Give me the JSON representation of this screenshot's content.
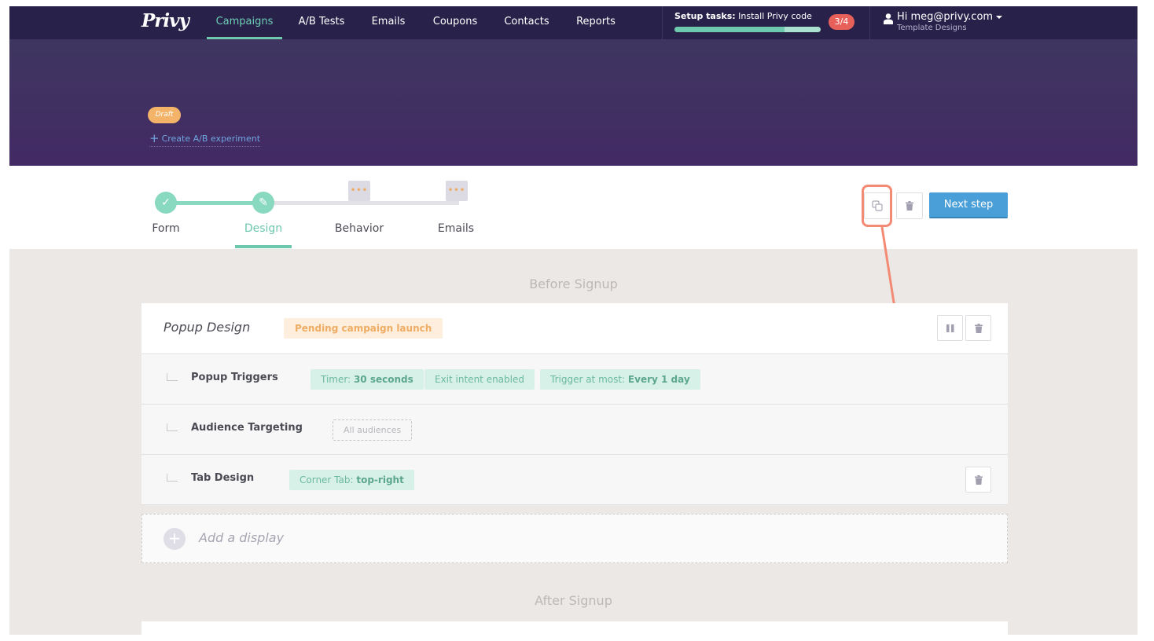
{
  "nav": {
    "logo": "Privy",
    "items": [
      {
        "label": "Campaigns",
        "active": true
      },
      {
        "label": "A/B Tests",
        "active": false
      },
      {
        "label": "Emails",
        "active": false
      },
      {
        "label": "Coupons",
        "active": false
      },
      {
        "label": "Contacts",
        "active": false
      },
      {
        "label": "Reports",
        "active": false
      }
    ],
    "setup": {
      "prefix": "Setup tasks:",
      "task": "Install Privy code",
      "count": "3/4",
      "progress_fraction": 0.75
    },
    "user": {
      "greeting": "Hi meg@privy.com",
      "org": "Template Designs"
    }
  },
  "banner": {
    "status_badge": "Draft",
    "ab_link_icon": "+",
    "ab_link": "Create A/B experiment"
  },
  "steps": {
    "items": [
      {
        "label": "Form",
        "state": "done",
        "icon": "check-icon",
        "glyph": "✓"
      },
      {
        "label": "Design",
        "state": "current",
        "icon": "brush-icon",
        "glyph": "✎"
      },
      {
        "label": "Behavior",
        "state": "pending",
        "icon": "ellipsis-icon",
        "glyph": "•••"
      },
      {
        "label": "Emails",
        "state": "pending",
        "icon": "ellipsis-icon",
        "glyph": "•••"
      }
    ],
    "actions": {
      "duplicate_icon": "duplicate-icon",
      "delete_icon": "trash-icon",
      "next_label": "Next step"
    }
  },
  "colors": {
    "nav_bg": "#28214a",
    "accent_green": "#6ec8ae",
    "primary_blue": "#4a9fd8",
    "badge_red": "#e8605a",
    "draft_orange": "#f3b46a",
    "annotation": "#f38a74"
  },
  "before_signup": {
    "title": "Before Signup",
    "popup": {
      "title": "Popup Design",
      "status": "Pending campaign launch"
    },
    "rows": [
      {
        "label": "Popup Triggers",
        "tags": [
          {
            "prefix": "Timer: ",
            "value": "30 seconds"
          },
          {
            "prefix": "Exit intent enabled",
            "value": ""
          },
          {
            "prefix": "Trigger at most: ",
            "value": "Every 1 day"
          }
        ]
      },
      {
        "label": "Audience Targeting",
        "tags": [
          {
            "prefix": "All audiences",
            "value": ""
          }
        ]
      },
      {
        "label": "Tab Design",
        "tags": [
          {
            "prefix": "Corner Tab: ",
            "value": "top-right"
          }
        ]
      }
    ],
    "add_display": {
      "icon": "+",
      "label": "Add a display"
    }
  },
  "after_signup": {
    "title": "After Signup"
  }
}
